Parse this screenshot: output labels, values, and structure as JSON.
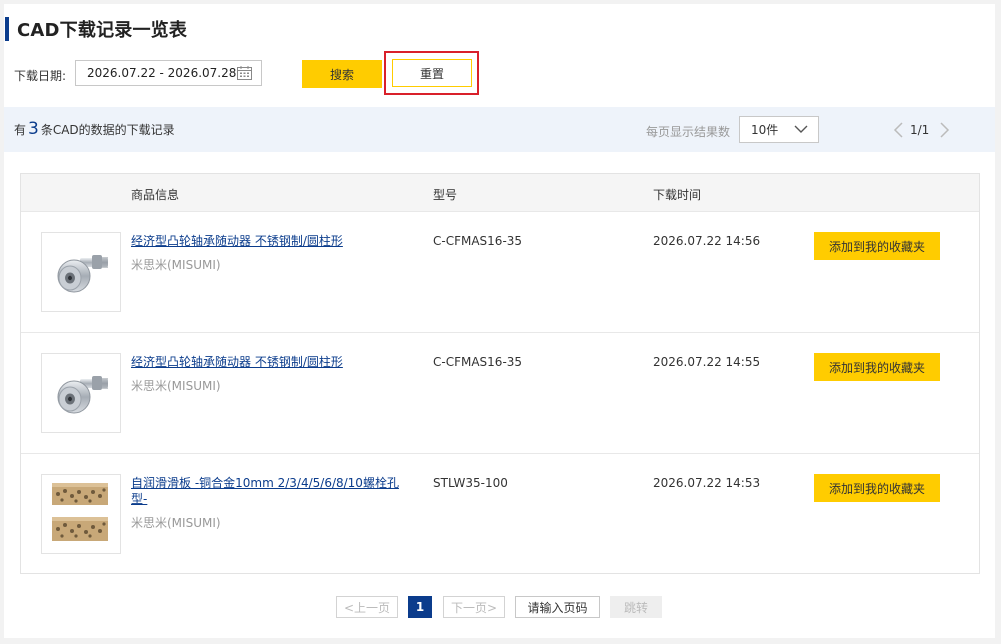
{
  "page": {
    "title": "CAD下载记录一览表"
  },
  "filter": {
    "date_label": "下载日期:",
    "date_range": "2026.07.22 - 2026.07.28",
    "search_label": "搜索",
    "reset_label": "重置"
  },
  "summary": {
    "prefix": "有",
    "count": "3",
    "suffix": "条CAD的数据的下载记录",
    "per_page_label": "每页显示结果数",
    "per_page_value": "10件",
    "page_indicator": "1/1"
  },
  "table": {
    "headers": {
      "product": "商品信息",
      "model": "型号",
      "time": "下载时间"
    },
    "rows": [
      {
        "name": "经济型凸轮轴承随动器 不锈钢制/圆柱形",
        "maker": "米思米(MISUMI)",
        "model": "C-CFMAS16-35",
        "time": "2026.07.22 14:56",
        "action": "添加到我的收藏夹",
        "image": "cam-follower"
      },
      {
        "name": "经济型凸轮轴承随动器 不锈钢制/圆柱形",
        "maker": "米思米(MISUMI)",
        "model": "C-CFMAS16-35",
        "time": "2026.07.22 14:55",
        "action": "添加到我的收藏夹",
        "image": "cam-follower"
      },
      {
        "name": "自润滑滑板 -铜合金10mm 2/3/4/5/6/8/10螺栓孔型-",
        "maker": "米思米(MISUMI)",
        "model": "STLW35-100",
        "time": "2026.07.22 14:53",
        "action": "添加到我的收藏夹",
        "image": "sliding-plate"
      }
    ]
  },
  "pagination": {
    "prev": "<上一页",
    "current": "1",
    "next": "下一页>",
    "input_placeholder": "请输入页码",
    "go": "跳转"
  },
  "colors": {
    "accent_yellow": "#ffcc00",
    "brand_blue": "#0b3c8c",
    "highlight_red": "#d9202a",
    "info_bar_bg": "#eef3fa"
  }
}
